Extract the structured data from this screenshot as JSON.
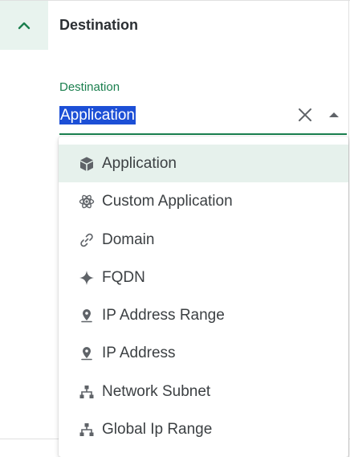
{
  "header": {
    "title": "Destination"
  },
  "field": {
    "label": "Destination",
    "value": "Application"
  },
  "colors": {
    "accent": "#1a7f4e",
    "selection": "#1c4fd6",
    "selected_option_bg": "#e6f1ec",
    "header_button_bg": "#e8f3ee"
  },
  "dropdown": {
    "options": [
      {
        "label": "Application",
        "icon": "cube-icon",
        "selected": true
      },
      {
        "label": "Custom Application",
        "icon": "atom-icon",
        "selected": false
      },
      {
        "label": "Domain",
        "icon": "link-icon",
        "selected": false
      },
      {
        "label": "FQDN",
        "icon": "sparkle-icon",
        "selected": false
      },
      {
        "label": "IP Address Range",
        "icon": "location-pin-icon",
        "selected": false
      },
      {
        "label": "IP Address",
        "icon": "location-pin-icon",
        "selected": false
      },
      {
        "label": "Network Subnet",
        "icon": "network-tree-icon",
        "selected": false
      },
      {
        "label": "Global Ip Range",
        "icon": "network-tree-icon",
        "selected": false
      }
    ]
  }
}
